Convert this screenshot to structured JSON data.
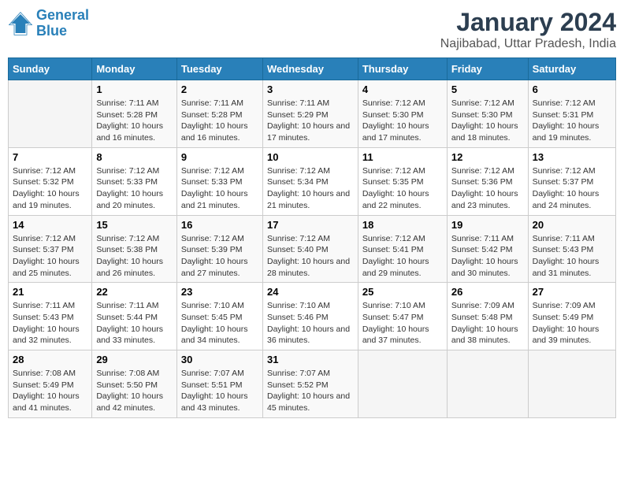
{
  "logo": {
    "text1": "General",
    "text2": "Blue"
  },
  "title": "January 2024",
  "subtitle": "Najibabad, Uttar Pradesh, India",
  "days_of_week": [
    "Sunday",
    "Monday",
    "Tuesday",
    "Wednesday",
    "Thursday",
    "Friday",
    "Saturday"
  ],
  "weeks": [
    [
      {
        "num": "",
        "sunrise": "",
        "sunset": "",
        "daylight": ""
      },
      {
        "num": "1",
        "sunrise": "Sunrise: 7:11 AM",
        "sunset": "Sunset: 5:28 PM",
        "daylight": "Daylight: 10 hours and 16 minutes."
      },
      {
        "num": "2",
        "sunrise": "Sunrise: 7:11 AM",
        "sunset": "Sunset: 5:28 PM",
        "daylight": "Daylight: 10 hours and 16 minutes."
      },
      {
        "num": "3",
        "sunrise": "Sunrise: 7:11 AM",
        "sunset": "Sunset: 5:29 PM",
        "daylight": "Daylight: 10 hours and 17 minutes."
      },
      {
        "num": "4",
        "sunrise": "Sunrise: 7:12 AM",
        "sunset": "Sunset: 5:30 PM",
        "daylight": "Daylight: 10 hours and 17 minutes."
      },
      {
        "num": "5",
        "sunrise": "Sunrise: 7:12 AM",
        "sunset": "Sunset: 5:30 PM",
        "daylight": "Daylight: 10 hours and 18 minutes."
      },
      {
        "num": "6",
        "sunrise": "Sunrise: 7:12 AM",
        "sunset": "Sunset: 5:31 PM",
        "daylight": "Daylight: 10 hours and 19 minutes."
      }
    ],
    [
      {
        "num": "7",
        "sunrise": "Sunrise: 7:12 AM",
        "sunset": "Sunset: 5:32 PM",
        "daylight": "Daylight: 10 hours and 19 minutes."
      },
      {
        "num": "8",
        "sunrise": "Sunrise: 7:12 AM",
        "sunset": "Sunset: 5:33 PM",
        "daylight": "Daylight: 10 hours and 20 minutes."
      },
      {
        "num": "9",
        "sunrise": "Sunrise: 7:12 AM",
        "sunset": "Sunset: 5:33 PM",
        "daylight": "Daylight: 10 hours and 21 minutes."
      },
      {
        "num": "10",
        "sunrise": "Sunrise: 7:12 AM",
        "sunset": "Sunset: 5:34 PM",
        "daylight": "Daylight: 10 hours and 21 minutes."
      },
      {
        "num": "11",
        "sunrise": "Sunrise: 7:12 AM",
        "sunset": "Sunset: 5:35 PM",
        "daylight": "Daylight: 10 hours and 22 minutes."
      },
      {
        "num": "12",
        "sunrise": "Sunrise: 7:12 AM",
        "sunset": "Sunset: 5:36 PM",
        "daylight": "Daylight: 10 hours and 23 minutes."
      },
      {
        "num": "13",
        "sunrise": "Sunrise: 7:12 AM",
        "sunset": "Sunset: 5:37 PM",
        "daylight": "Daylight: 10 hours and 24 minutes."
      }
    ],
    [
      {
        "num": "14",
        "sunrise": "Sunrise: 7:12 AM",
        "sunset": "Sunset: 5:37 PM",
        "daylight": "Daylight: 10 hours and 25 minutes."
      },
      {
        "num": "15",
        "sunrise": "Sunrise: 7:12 AM",
        "sunset": "Sunset: 5:38 PM",
        "daylight": "Daylight: 10 hours and 26 minutes."
      },
      {
        "num": "16",
        "sunrise": "Sunrise: 7:12 AM",
        "sunset": "Sunset: 5:39 PM",
        "daylight": "Daylight: 10 hours and 27 minutes."
      },
      {
        "num": "17",
        "sunrise": "Sunrise: 7:12 AM",
        "sunset": "Sunset: 5:40 PM",
        "daylight": "Daylight: 10 hours and 28 minutes."
      },
      {
        "num": "18",
        "sunrise": "Sunrise: 7:12 AM",
        "sunset": "Sunset: 5:41 PM",
        "daylight": "Daylight: 10 hours and 29 minutes."
      },
      {
        "num": "19",
        "sunrise": "Sunrise: 7:11 AM",
        "sunset": "Sunset: 5:42 PM",
        "daylight": "Daylight: 10 hours and 30 minutes."
      },
      {
        "num": "20",
        "sunrise": "Sunrise: 7:11 AM",
        "sunset": "Sunset: 5:43 PM",
        "daylight": "Daylight: 10 hours and 31 minutes."
      }
    ],
    [
      {
        "num": "21",
        "sunrise": "Sunrise: 7:11 AM",
        "sunset": "Sunset: 5:43 PM",
        "daylight": "Daylight: 10 hours and 32 minutes."
      },
      {
        "num": "22",
        "sunrise": "Sunrise: 7:11 AM",
        "sunset": "Sunset: 5:44 PM",
        "daylight": "Daylight: 10 hours and 33 minutes."
      },
      {
        "num": "23",
        "sunrise": "Sunrise: 7:10 AM",
        "sunset": "Sunset: 5:45 PM",
        "daylight": "Daylight: 10 hours and 34 minutes."
      },
      {
        "num": "24",
        "sunrise": "Sunrise: 7:10 AM",
        "sunset": "Sunset: 5:46 PM",
        "daylight": "Daylight: 10 hours and 36 minutes."
      },
      {
        "num": "25",
        "sunrise": "Sunrise: 7:10 AM",
        "sunset": "Sunset: 5:47 PM",
        "daylight": "Daylight: 10 hours and 37 minutes."
      },
      {
        "num": "26",
        "sunrise": "Sunrise: 7:09 AM",
        "sunset": "Sunset: 5:48 PM",
        "daylight": "Daylight: 10 hours and 38 minutes."
      },
      {
        "num": "27",
        "sunrise": "Sunrise: 7:09 AM",
        "sunset": "Sunset: 5:49 PM",
        "daylight": "Daylight: 10 hours and 39 minutes."
      }
    ],
    [
      {
        "num": "28",
        "sunrise": "Sunrise: 7:08 AM",
        "sunset": "Sunset: 5:49 PM",
        "daylight": "Daylight: 10 hours and 41 minutes."
      },
      {
        "num": "29",
        "sunrise": "Sunrise: 7:08 AM",
        "sunset": "Sunset: 5:50 PM",
        "daylight": "Daylight: 10 hours and 42 minutes."
      },
      {
        "num": "30",
        "sunrise": "Sunrise: 7:07 AM",
        "sunset": "Sunset: 5:51 PM",
        "daylight": "Daylight: 10 hours and 43 minutes."
      },
      {
        "num": "31",
        "sunrise": "Sunrise: 7:07 AM",
        "sunset": "Sunset: 5:52 PM",
        "daylight": "Daylight: 10 hours and 45 minutes."
      },
      {
        "num": "",
        "sunrise": "",
        "sunset": "",
        "daylight": ""
      },
      {
        "num": "",
        "sunrise": "",
        "sunset": "",
        "daylight": ""
      },
      {
        "num": "",
        "sunrise": "",
        "sunset": "",
        "daylight": ""
      }
    ]
  ]
}
